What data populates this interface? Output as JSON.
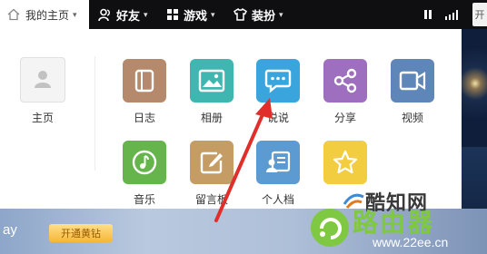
{
  "topbar": {
    "home": "我的主页",
    "friends": "好友",
    "games": "游戏",
    "dress": "装扮",
    "edge_button": "开"
  },
  "profile": {
    "home_label": "主页"
  },
  "apps": [
    {
      "label": "日志",
      "color": "#b58a6c",
      "icon": "journal-icon"
    },
    {
      "label": "相册",
      "color": "#3fb7b0",
      "icon": "photo-icon"
    },
    {
      "label": "说说",
      "color": "#3aa5dd",
      "icon": "chat-bubble-icon"
    },
    {
      "label": "分享",
      "color": "#9d6fbe",
      "icon": "share-icon"
    },
    {
      "label": "视频",
      "color": "#5f86b8",
      "icon": "video-icon"
    },
    {
      "label": "音乐",
      "color": "#66b54c",
      "icon": "music-icon"
    },
    {
      "label": "留言板",
      "color": "#c59c63",
      "icon": "message-board-icon"
    },
    {
      "label": "个人档",
      "color": "#5b9bd1",
      "icon": "profile-card-icon"
    },
    {
      "label": "",
      "color": "#f2cd3f",
      "icon": "star-icon"
    }
  ],
  "bottom": {
    "left_text": "ay",
    "open_button": "开通黄钻"
  },
  "watermarks": {
    "top": "酷知网",
    "main": "路由器",
    "url": "www.22ee.cn"
  }
}
